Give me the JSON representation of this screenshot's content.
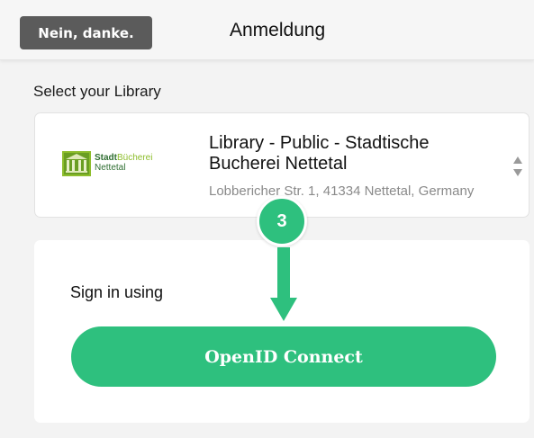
{
  "header": {
    "decline_label": "Nein, danke.",
    "title": "Anmeldung"
  },
  "library_select": {
    "label": "Select your Library",
    "logo_line1_a": "Stadt",
    "logo_line1_b": "Bücherei",
    "logo_line2": "Nettetal",
    "name": "Library - Public - Stadtische Bucherei Nettetal",
    "address": "Lobbericher Str. 1, 41334 Nettetal, Germany"
  },
  "signin": {
    "label": "Sign in using",
    "openid_label": "OpenID Connect"
  },
  "step_marker": {
    "number": "3"
  },
  "colors": {
    "accent_green": "#2ec07e",
    "decline_button": "#5b5b5b",
    "logo_green": "#2f6e32",
    "logo_lime": "#8dbd2c"
  },
  "icons": {
    "select_arrows": "updown-arrows-icon",
    "step_arrow": "arrow-down-icon",
    "logo_building": "library-building-icon"
  }
}
